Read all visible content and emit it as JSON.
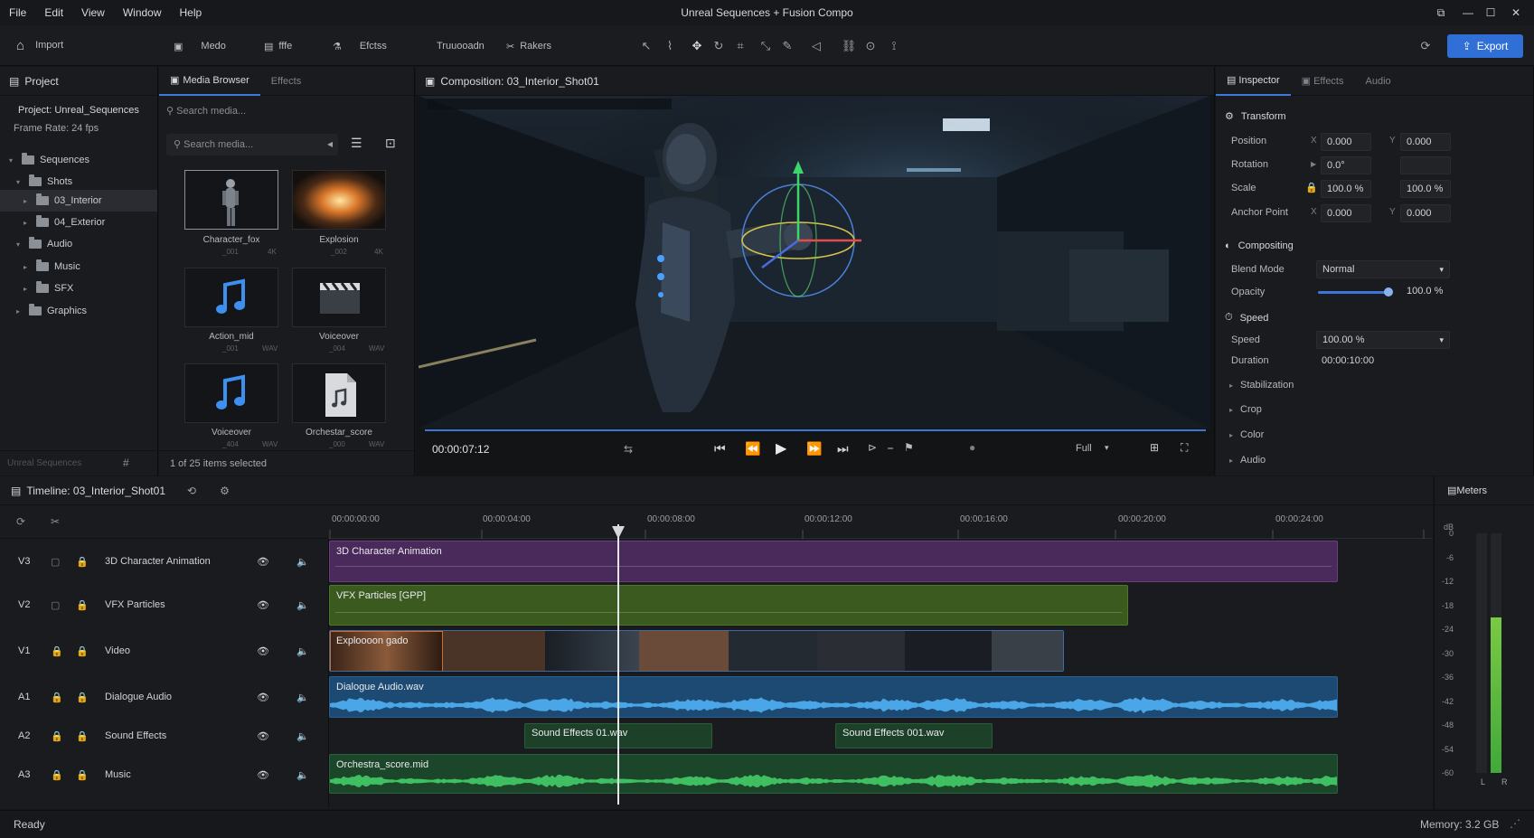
{
  "window": {
    "title": "Unreal Sequences + Fusion Compo"
  },
  "menu": [
    "File",
    "Edit",
    "View",
    "Window",
    "Help"
  ],
  "toolbar": {
    "import_label": "Import",
    "tool_media": "Medo",
    "tool_fx": "fffe",
    "tool_effects": "Efctss",
    "tool_transform": "Truuooadn",
    "tool_markers": "Rakers",
    "export_label": "Export"
  },
  "project": {
    "panel_title": "Project",
    "name": "Project: Unreal_Sequences",
    "frame_rate": "Frame Rate: 24 fps",
    "tree": [
      "Sequences",
      "Shots",
      "03_Interior",
      "04_Exterior",
      "Audio",
      "Music",
      "SFX",
      "Graphics"
    ],
    "footer": "Unreal Sequences"
  },
  "media": {
    "tab_browser": "Media Browser",
    "tab_effects": "Effects",
    "search_placeholder_1": "Search media...",
    "search_placeholder_2": "Search media...",
    "items": [
      {
        "label": "Character_fox",
        "meta_a": "_001",
        "meta_b": "4K"
      },
      {
        "label": "Explosion",
        "meta_a": "_002",
        "meta_b": "4K"
      },
      {
        "label": "Action_mid",
        "meta_a": "_001",
        "meta_b": "WAV"
      },
      {
        "label": "Voiceover",
        "meta_a": "_004",
        "meta_b": "WAV"
      },
      {
        "label": "Voiceover",
        "meta_a": "_404",
        "meta_b": "WAV"
      },
      {
        "label": "Orchestar_score",
        "meta_a": "_000",
        "meta_b": "WAV"
      }
    ],
    "status": "1 of 25 items selected"
  },
  "viewer": {
    "title": "Composition: 03_Interior_Shot01",
    "timecode": "00:00:07:12",
    "zoom": "Full"
  },
  "inspector": {
    "tab_inspector": "Inspector",
    "tab_effects": "Effects",
    "tab_audio": "Audio",
    "transform": "Transform",
    "position": "Position",
    "pos_x": "0.000",
    "pos_y": "0.000",
    "rotation": "Rotation",
    "rot_val": "0.0°",
    "scale": "Scale",
    "scale_x": "100.0 %",
    "scale_y": "100.0 %",
    "anchor": "Anchor Point",
    "anchor_x": "0.000",
    "anchor_y": "0.000",
    "x": "X",
    "y": "Y",
    "compositing": "Compositing",
    "blend_mode": "Blend Mode",
    "blend_val": "Normal",
    "opacity": "Opacity",
    "opacity_val": "100.0 %",
    "opacity_level": 0.97,
    "speed_sec": "Speed",
    "speed": "Speed",
    "speed_val": "100.00 %",
    "duration": "Duration",
    "duration_val": "00:00:10:00",
    "stabilization": "Stabilization",
    "crop": "Crop",
    "color": "Color",
    "audio": "Audio"
  },
  "timeline": {
    "title": "Timeline: 03_Interior_Shot01",
    "ruler": [
      "00:00:00:00",
      "00:00:04:00",
      "00:00:08:00",
      "00:00:12:00",
      "00:00:16:00",
      "00:00:20:00",
      "00:00:24:00"
    ],
    "tracks": [
      {
        "id": "V3",
        "name": "3D Character Animation"
      },
      {
        "id": "V2",
        "name": "VFX Particles"
      },
      {
        "id": "V1",
        "name": "Video"
      },
      {
        "id": "A1",
        "name": "Dialogue Audio"
      },
      {
        "id": "A2",
        "name": "Sound Effects"
      },
      {
        "id": "A3",
        "name": "Music"
      }
    ],
    "clips": {
      "v3": "3D Character Animation",
      "v2": "VFX Particles [GPP]",
      "v1": "Exploooon gado",
      "a1": "Dialogue Audio.wav",
      "a2a": "Sound Effects 01.wav",
      "a2b": "Sound Effects 001.wav",
      "a3": "Orchestra_score.mid"
    }
  },
  "meters": {
    "title": "Meters",
    "db": "dB",
    "scale": [
      "0",
      "-6",
      "-12",
      "-18",
      "-24",
      "-30",
      "-36",
      "-42",
      "-48",
      "-54",
      "-60"
    ],
    "left": "L",
    "right": "R",
    "level_right": 0.65
  },
  "status": {
    "left": "Ready",
    "right": "Memory: 3.2 GB"
  },
  "colors": {
    "accent": "#2f6fd6",
    "v3": "#5b2d6e",
    "v2": "#3d5d22",
    "a1": "#1f4f7a",
    "a3": "#1d4a2c"
  }
}
